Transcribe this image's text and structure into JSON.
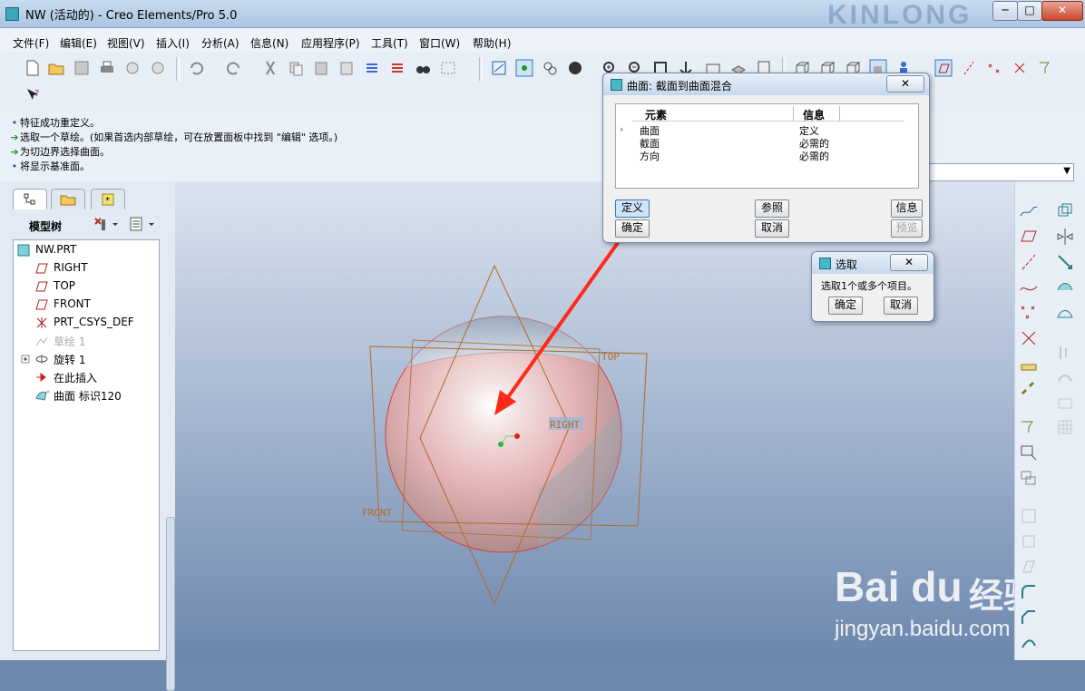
{
  "window": {
    "title": "NW (活动的) - Creo Elements/Pro 5.0",
    "brand_text": "KINLONG",
    "min_label": "─",
    "max_label": "□",
    "close_label": "✕"
  },
  "menu": [
    "文件(F)",
    "编辑(E)",
    "视图(V)",
    "插入(I)",
    "分析(A)",
    "信息(N)",
    "应用程序(P)",
    "工具(T)",
    "窗口(W)",
    "帮助(H)"
  ],
  "messages": [
    {
      "icon": "info-bullet",
      "text": "特征成功重定义。"
    },
    {
      "icon": "green-arrow",
      "text": "选取一个草绘。(如果首选内部草绘，可在放置面板中找到 \"编辑\" 选项。)"
    },
    {
      "icon": "green-arrow",
      "text": "为切边界选择曲面。"
    },
    {
      "icon": "info-bullet",
      "text": "将显示基准面。"
    }
  ],
  "model_tree": {
    "title": "模型树",
    "items": [
      {
        "label": "NW.PRT",
        "icon": "part-icon",
        "dim": false
      },
      {
        "label": "RIGHT",
        "icon": "datum-plane-icon",
        "dim": false
      },
      {
        "label": "TOP",
        "icon": "datum-plane-icon",
        "dim": false
      },
      {
        "label": "FRONT",
        "icon": "datum-plane-icon",
        "dim": false
      },
      {
        "label": "PRT_CSYS_DEF",
        "icon": "csys-icon",
        "dim": false
      },
      {
        "label": "草绘 1",
        "icon": "sketch-icon",
        "dim": true
      },
      {
        "label": "旋转 1",
        "icon": "revolve-icon",
        "dim": false
      },
      {
        "label": "在此插入",
        "icon": "insert-here-arrow-icon",
        "dim": false
      },
      {
        "label": "曲面 标识120",
        "icon": "surface-icon",
        "dim": false
      }
    ]
  },
  "datum_labels": {
    "top": "TOP",
    "right": "RIGHT",
    "front": "FRONT"
  },
  "blend_dialog": {
    "title": "曲面: 截面到曲面混合",
    "close_label": "✕",
    "headers": [
      "元素",
      "信息"
    ],
    "rows": [
      {
        "element": "曲面",
        "info": "定义",
        "current": true
      },
      {
        "element": "截面",
        "info": "必需的",
        "current": false
      },
      {
        "element": "方向",
        "info": "必需的",
        "current": false
      }
    ],
    "buttons": {
      "define": "定义",
      "refs": "参照",
      "info": "信息",
      "ok": "确定",
      "cancel": "取消",
      "preview": "预览"
    }
  },
  "select_dialog": {
    "title": "选取",
    "close_label": "✕",
    "prompt": "选取1个或多个项目。",
    "ok": "确定",
    "cancel": "取消"
  },
  "watermark": {
    "logo": "Bai du",
    "cn": "经验",
    "url": "jingyan.baidu.com"
  },
  "colors": {
    "accent_arrow": "#ff2a1a",
    "datum_plane": "#b06a2a",
    "sphere_pink": "#e7b3b3"
  }
}
